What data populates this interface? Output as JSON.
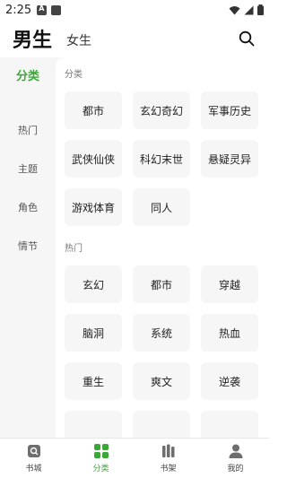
{
  "status": {
    "time": "2:25"
  },
  "header": {
    "tab_male": "男生",
    "tab_female": "女生",
    "search_icon": "search-icon"
  },
  "sidebar": {
    "items": [
      {
        "label": "分类",
        "active": true
      },
      {
        "label": "热门",
        "active": false
      },
      {
        "label": "主题",
        "active": false
      },
      {
        "label": "角色",
        "active": false
      },
      {
        "label": "情节",
        "active": false
      }
    ]
  },
  "sections": [
    {
      "title": "分类",
      "chips": [
        "都市",
        "玄幻奇幻",
        "军事历史",
        "武侠仙侠",
        "科幻末世",
        "悬疑灵异",
        "游戏体育",
        "同人"
      ]
    },
    {
      "title": "热门",
      "chips": [
        "玄幻",
        "都市",
        "穿越",
        "脑洞",
        "系统",
        "热血",
        "重生",
        "爽文",
        "逆袭"
      ]
    }
  ],
  "bottom_nav": {
    "items": [
      {
        "label": "书城",
        "icon": "bookstore-icon",
        "active": false
      },
      {
        "label": "分类",
        "icon": "category-grid-icon",
        "active": true
      },
      {
        "label": "书架",
        "icon": "bookshelf-icon",
        "active": false
      },
      {
        "label": "我的",
        "icon": "profile-icon",
        "active": false
      }
    ]
  },
  "colors": {
    "accent": "#3aa835",
    "chip_bg": "#f6f6f6"
  }
}
